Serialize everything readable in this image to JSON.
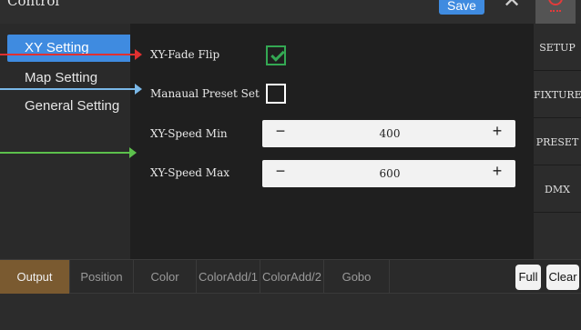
{
  "window": {
    "title": "Control",
    "save_label": "Save"
  },
  "sidebar": {
    "items": [
      {
        "label": "XY Setting",
        "active": true
      },
      {
        "label": "Map Setting",
        "active": false
      },
      {
        "label": "General Setting",
        "active": false
      }
    ]
  },
  "settings": {
    "fade_flip": {
      "label": "XY-Fade Flip",
      "checked": true
    },
    "preset_set": {
      "label": "Manaual Preset Set",
      "checked": false
    },
    "speed_min": {
      "label": "XY-Speed Min",
      "value": "400",
      "minus": "−",
      "plus": "+"
    },
    "speed_max": {
      "label": "XY-Speed Max",
      "value": "600",
      "minus": "−",
      "plus": "+"
    }
  },
  "right_nav": {
    "items": [
      "SETUP",
      "FIXTURE",
      "PRESET",
      "DMX"
    ]
  },
  "bottom_tabs": {
    "items": [
      "Output",
      "Position",
      "Color",
      "ColorAdd/1",
      "ColorAdd/2",
      "Gobo"
    ],
    "active": "Output",
    "full_label": "Full",
    "clear_label": "Clear"
  },
  "icons": {
    "close": "close-icon",
    "power": "power-icon",
    "check": "checkmark-icon"
  },
  "colors": {
    "accent_blue": "#3f8be0",
    "active_tab": "#7a5a30",
    "check_green": "#34a853",
    "arrow_red": "#e03030",
    "arrow_blue": "#7ab8e8",
    "arrow_green": "#5cc04c",
    "power_red": "#e23b3b"
  }
}
